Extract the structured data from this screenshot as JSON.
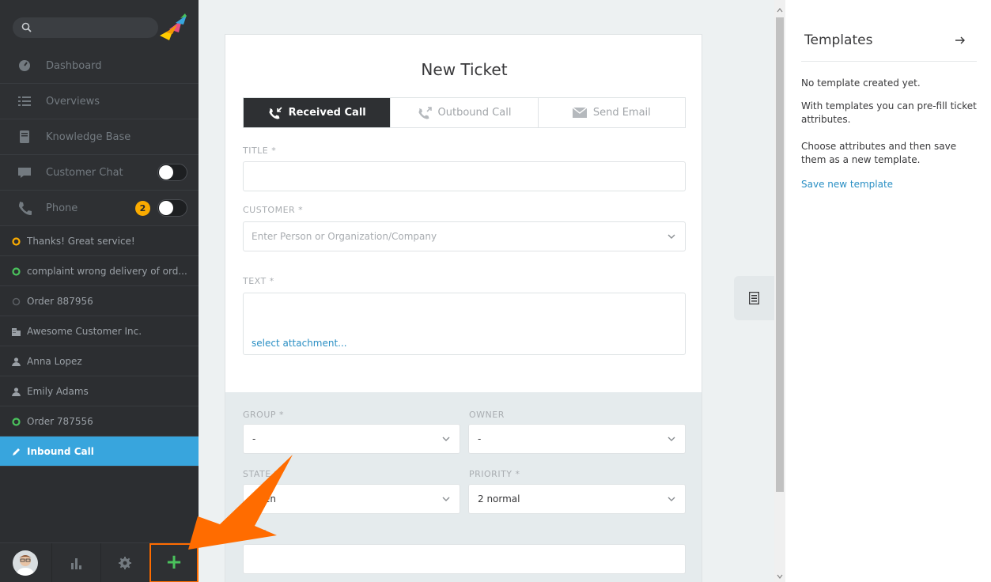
{
  "sidebar": {
    "search": {
      "placeholder": ""
    },
    "nav": [
      {
        "label": "Dashboard",
        "icon": "dashboard-icon"
      },
      {
        "label": "Overviews",
        "icon": "list-icon"
      },
      {
        "label": "Knowledge Base",
        "icon": "book-icon"
      },
      {
        "label": "Customer Chat",
        "icon": "chat-icon",
        "toggle": false
      },
      {
        "label": "Phone",
        "icon": "phone-icon",
        "badge": "2",
        "toggle": false
      }
    ],
    "tasks": [
      {
        "label": "Thanks! Great service!",
        "icon": "ticket-open-icon",
        "color": "#faab00"
      },
      {
        "label": "complaint wrong delivery of ord...",
        "icon": "ticket-open-icon",
        "color": "#4ac25c"
      },
      {
        "label": "Order 887956",
        "icon": "ticket-closed-icon",
        "color": "#5a5e63"
      },
      {
        "label": "Awesome Customer Inc.",
        "icon": "organization-icon"
      },
      {
        "label": "Anna Lopez",
        "icon": "user-icon"
      },
      {
        "label": "Emily Adams",
        "icon": "user-icon"
      },
      {
        "label": "Order 787556",
        "icon": "ticket-open-icon",
        "color": "#4ac25c"
      },
      {
        "label": "Inbound Call",
        "icon": "pencil-icon",
        "active": true
      }
    ],
    "bottom": {
      "add_label": "+"
    }
  },
  "form": {
    "title": "New Ticket",
    "tabs": [
      {
        "label": "Received Call",
        "icon": "received-call-icon",
        "active": true
      },
      {
        "label": "Outbound Call",
        "icon": "outbound-call-icon",
        "active": false
      },
      {
        "label": "Send Email",
        "icon": "email-icon",
        "active": false
      }
    ],
    "title_label": "TITLE *",
    "title_value": "",
    "customer_label": "CUSTOMER *",
    "customer_placeholder": "Enter Person or Organization/Company",
    "text_label": "TEXT *",
    "attachment_link": "select attachment...",
    "group_label": "GROUP *",
    "group_value": "-",
    "owner_label": "OWNER",
    "owner_value": "-",
    "state_label": "STATE *",
    "state_value": "open",
    "priority_label": "PRIORITY *",
    "priority_value": "2 normal",
    "tags_label": "TAGS",
    "tags_value": ""
  },
  "templates": {
    "title": "Templates",
    "empty": "No template created yet.",
    "desc1": "With templates you can pre-fill ticket attributes.",
    "desc2": "Choose attributes and then save them as a new template.",
    "save_link": "Save new template"
  },
  "colors": {
    "accent": "#38a5dd",
    "highlight": "#ff6c00",
    "add": "#4ac25c",
    "badge": "#faab00"
  }
}
